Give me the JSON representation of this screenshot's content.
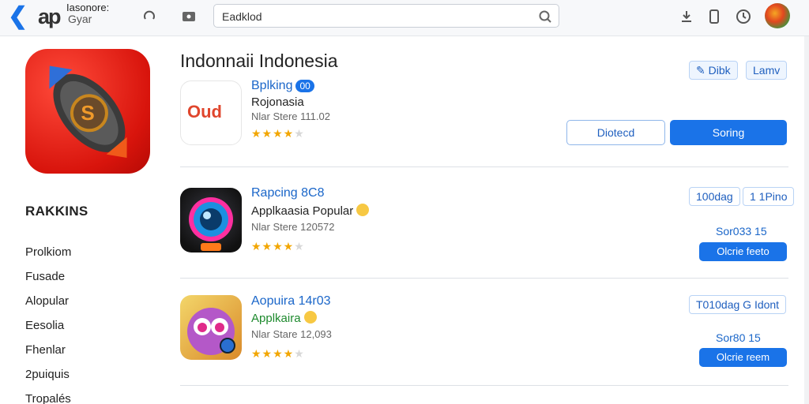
{
  "header": {
    "app_title": "Iasonore:",
    "app_subtitle": "Gyar",
    "app_logo_text": "ap",
    "search_value": "Eadklod",
    "icons": [
      "back-icon",
      "refresh-icon",
      "image-icon",
      "search-icon",
      "download-icon",
      "phone-icon",
      "clock-icon",
      "avatar"
    ]
  },
  "sidebar": {
    "rankings_title": "RAKKINS",
    "items": [
      "Prolkiom",
      "Fusade",
      "Alopular",
      "Eesolia",
      "Fhenlar",
      "2puiquis",
      "Tropalés"
    ]
  },
  "main": {
    "title": "Indonnaii Indonesia",
    "pills": [
      "Dibk",
      "Lamv"
    ],
    "featured": {
      "icon_text": "Oud",
      "name": "Bplking",
      "badge": "00",
      "subtitle": "Rojonasia",
      "meta": "Nlar Stere 111.02",
      "rating": 4,
      "secondary_button": "Diotecd",
      "primary_button": "Soring"
    },
    "rows": [
      {
        "name": "Rapcing 8C8",
        "subtitle": "Applkaasia Popular",
        "meta": "Nlar Stere 120572",
        "rating": 4,
        "pills": [
          "100dag",
          "1 1Pino"
        ],
        "score": "Sor033 15",
        "button": "Olcrie feeto",
        "icon": "camera-lens-icon"
      },
      {
        "name": "Aopuira 14r03",
        "subtitle": "Applkaira",
        "meta": "Nlar Stare 12,093",
        "rating": 4,
        "pills": [
          "T010dag G Idont"
        ],
        "score": "Sor80 15",
        "button": "Olcrie reem",
        "icon": "cartoon-owl-icon"
      }
    ]
  },
  "colors": {
    "accent": "#1a73e8",
    "star": "#f2a600",
    "hero_red": "#d8140c"
  }
}
